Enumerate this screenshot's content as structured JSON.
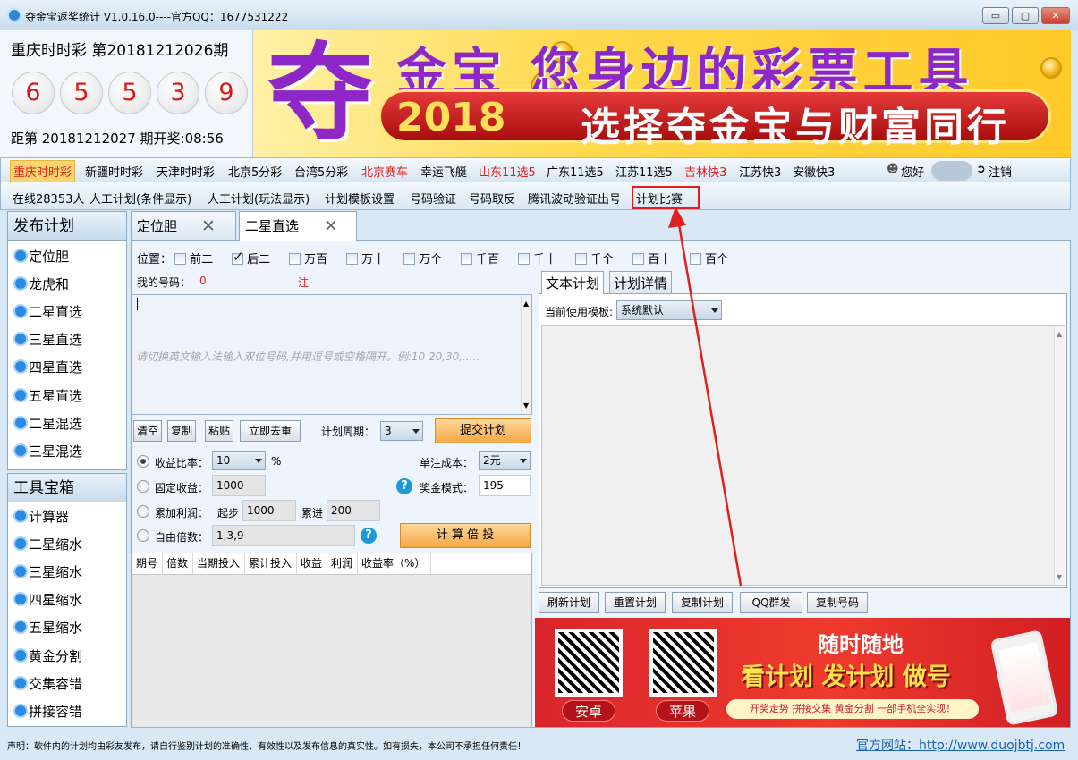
{
  "window": {
    "title": "夺金宝返奖统计  V1.0.16.0----官方QQ：1677531222",
    "controls": {
      "minimize": "▭",
      "maximize": "▢",
      "close": "✕"
    }
  },
  "draw": {
    "title": "重庆时时彩  第20181212026期",
    "numbers": [
      "6",
      "5",
      "5",
      "3",
      "9"
    ],
    "next": "距第 20181212027 期开奖:08:56"
  },
  "banner": {
    "brand_char": "夺",
    "line1": "金宝  您身边的彩票工具",
    "year": "2018",
    "slogan": "选择夺金宝与财富同行"
  },
  "lottery_bar": {
    "items": [
      {
        "label": "重庆时时彩",
        "style": "selected"
      },
      {
        "label": "新疆时时彩",
        "style": "normal"
      },
      {
        "label": "天津时时彩",
        "style": "normal"
      },
      {
        "label": "北京5分彩",
        "style": "normal"
      },
      {
        "label": "台湾5分彩",
        "style": "normal"
      },
      {
        "label": "北京赛车",
        "style": "red"
      },
      {
        "label": "幸运飞艇",
        "style": "normal"
      },
      {
        "label": "山东11选5",
        "style": "red"
      },
      {
        "label": "广东11选5",
        "style": "normal"
      },
      {
        "label": "江苏11选5",
        "style": "normal"
      },
      {
        "label": "吉林快3",
        "style": "red"
      },
      {
        "label": "江苏快3",
        "style": "normal"
      },
      {
        "label": "安徽快3",
        "style": "normal"
      }
    ],
    "greeting": "您好",
    "logout": "注销"
  },
  "menu_bar": {
    "online": "在线28353人",
    "items": [
      "人工计划(条件显示)",
      "人工计划(玩法显示)",
      "计划模板设置",
      "号码验证",
      "号码取反",
      "腾讯波动验证出号",
      "计划比赛"
    ]
  },
  "sidebar_plan": {
    "header": "发布计划",
    "items": [
      "定位胆",
      "龙虎和",
      "二星直选",
      "三星直选",
      "四星直选",
      "五星直选",
      "二星混选",
      "三星混选"
    ]
  },
  "sidebar_tools": {
    "header": "工具宝箱",
    "items": [
      "计算器",
      "二星缩水",
      "三星缩水",
      "四星缩水",
      "五星缩水",
      "黄金分割",
      "交集容错",
      "拼接容错"
    ]
  },
  "tabs": [
    {
      "label": "定位胆",
      "close": "✕"
    },
    {
      "label": "二星直选",
      "close": "✕"
    }
  ],
  "positions": {
    "label": "位置：",
    "options": [
      {
        "label": "前二",
        "checked": false
      },
      {
        "label": "后二",
        "checked": true
      },
      {
        "label": "万百",
        "checked": false
      },
      {
        "label": "万十",
        "checked": false
      },
      {
        "label": "万个",
        "checked": false
      },
      {
        "label": "千百",
        "checked": false
      },
      {
        "label": "千十",
        "checked": false
      },
      {
        "label": "千个",
        "checked": false
      },
      {
        "label": "百十",
        "checked": false
      },
      {
        "label": "百个",
        "checked": false
      }
    ]
  },
  "my_numbers": {
    "label": "我的号码：",
    "count": "0",
    "unit": "注",
    "placeholder": "请切换英文输入法输入双位号码,并用逗号或空格隔开。例:10 20,30,....."
  },
  "actions": {
    "clear": "清空",
    "copy": "复制",
    "paste": "粘贴",
    "dedupe": "立即去重",
    "period_label": "计划周期：",
    "period_value": "3",
    "submit": "提交计划"
  },
  "calc": {
    "ratio_label": "收益比率：",
    "ratio_value": "10",
    "ratio_unit": "%",
    "unit_cost_label": "单注成本：",
    "unit_cost_value": "2元",
    "fixed_label": "固定收益：",
    "fixed_value": "1000",
    "prize_label": "奖金模式：",
    "prize_value": "195",
    "cumulative_label": "累加利润：",
    "start_label": "起步",
    "start_value": "1000",
    "step_label": "累进",
    "step_value": "200",
    "free_label": "自由倍数：",
    "free_value": "1,3,9",
    "calc_button": "计 算 倍 投",
    "help": "?"
  },
  "result_table": {
    "columns": [
      "期号",
      "倍数",
      "当期投入",
      "累计投入",
      "收益",
      "利润",
      "收益率（%）"
    ]
  },
  "right_panel": {
    "tabs": [
      "文本计划",
      "计划详情"
    ],
    "template_label": "当前使用模板:",
    "template_value": "系统默认",
    "buttons": [
      "刷新计划",
      "重置计划",
      "复制计划",
      "QQ群发",
      "复制号码"
    ]
  },
  "ad": {
    "android": "安卓",
    "apple": "苹果",
    "headline": "随时随地",
    "sub": "看计划 发计划 做号",
    "footer": "开奖走势  拼接交集  黄金分割  一部手机全实现！"
  },
  "status": {
    "notice": "声明：软件内的计划均由彩友发布，请自行鉴别计划的准确性、有效性以及发布信息的真实性。如有损失，本公司不承担任何责任！",
    "website": "官方网站：http://www.duojbtj.com"
  },
  "colors": {
    "accent_red": "#e31c1c",
    "selected_bg": "#f5d36e",
    "brand_purple": "#8e27c8",
    "arrow": "#e02020"
  }
}
